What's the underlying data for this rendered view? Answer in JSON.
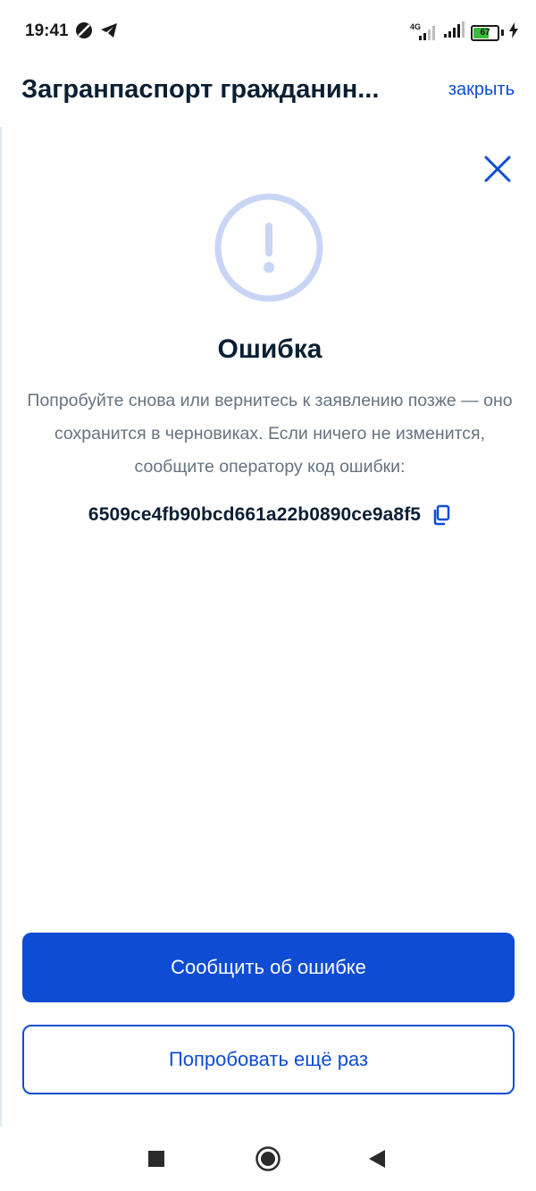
{
  "status_bar": {
    "time": "19:41",
    "network": "4G",
    "battery": "67",
    "icons": [
      "do-not-disturb-icon",
      "telegram-icon",
      "signal-4g-icon",
      "signal-icon",
      "battery-icon",
      "charging-icon"
    ]
  },
  "header": {
    "title": "Загранпаспорт гражданин...",
    "close_label": "закрыть"
  },
  "dialog": {
    "close_icon": "close-icon",
    "alert_icon": "exclamation-circle-icon",
    "title": "Ошибка",
    "description": "Попробуйте снова или вернитесь к заявлению позже — оно сохранится в черновиках. Если ничего не изменится, сообщите оператору код ошибки:",
    "error_code": "6509ce4fb90bcd661a22b0890ce9a8f5",
    "copy_icon": "copy-icon"
  },
  "actions": {
    "report_label": "Сообщить об ошибке",
    "retry_label": "Попробовать ещё раз"
  },
  "nav": {
    "icons": [
      "recents-square-icon",
      "home-circle-icon",
      "back-triangle-icon"
    ]
  },
  "colors": {
    "accent": "#0d4cd3",
    "text_primary": "#0b1f33",
    "text_secondary": "#66727f",
    "alert_ring": "#c8d5f5",
    "battery_fill": "#3dbb3d"
  },
  "battery_level": 0.67
}
